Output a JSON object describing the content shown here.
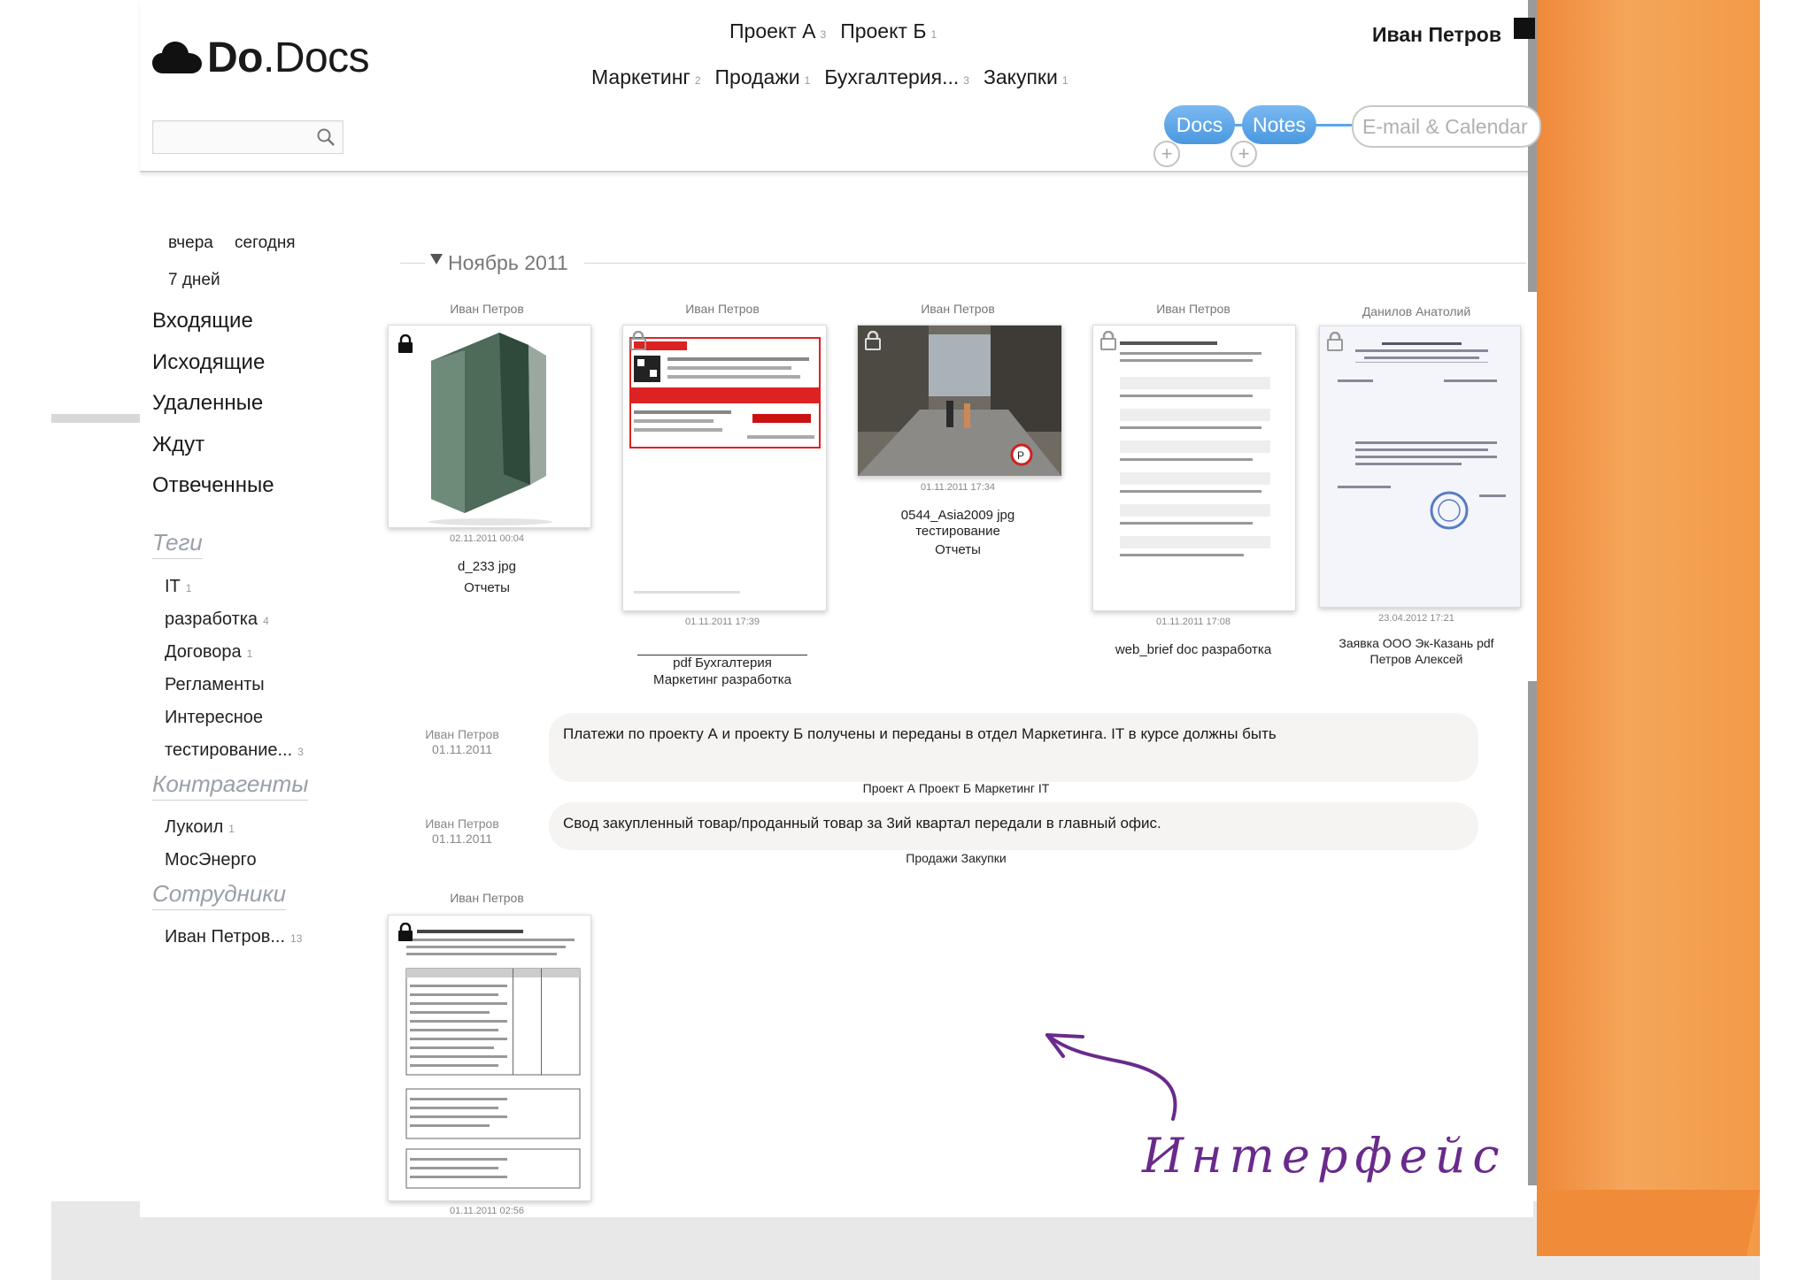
{
  "app": {
    "logo_bold": "Do",
    "logo_rest": ".Docs"
  },
  "search": {
    "placeholder": ""
  },
  "nav": {
    "row1": [
      {
        "label": "Проект А",
        "count": "3"
      },
      {
        "label": "Проект Б",
        "count": "1"
      }
    ],
    "row2": [
      {
        "label": "Маркетинг",
        "count": "2"
      },
      {
        "label": "Продажи",
        "count": "1"
      },
      {
        "label": "Бухгалтерия...",
        "count": "3"
      },
      {
        "label": "Закупки",
        "count": "1"
      }
    ]
  },
  "user": {
    "name": "Иван Петров"
  },
  "tabs": {
    "docs": "Docs",
    "notes": "Notes",
    "email": "E-mail & Calendar"
  },
  "sidebar": {
    "yesterday": "вчера",
    "today": "сегодня",
    "week": "7 дней",
    "folders": [
      "Входящие",
      "Исходящие",
      "Удаленные",
      "Ждут",
      "Отвеченные"
    ],
    "tags_heading": "Теги",
    "tags": [
      {
        "label": "IT",
        "count": "1"
      },
      {
        "label": "разработка",
        "count": "4"
      },
      {
        "label": "Договора",
        "count": "1"
      },
      {
        "label": "Регламенты",
        "count": ""
      },
      {
        "label": "Интересное",
        "count": ""
      },
      {
        "label": "тестирование...",
        "count": "3"
      }
    ],
    "contractors_heading": "Контрагенты",
    "contractors": [
      {
        "label": "Лукоил",
        "count": "1"
      },
      {
        "label": "МосЭнерго",
        "count": ""
      }
    ],
    "employees_heading": "Сотрудники",
    "employees": [
      {
        "label": "Иван Петров...",
        "count": "13"
      }
    ]
  },
  "month": "Ноябрь 2011",
  "docs": [
    {
      "author": "Иван Петров",
      "date": "02.11.2011 00:04",
      "line1": "d_233 jpg",
      "line2": "Отчеты"
    },
    {
      "author": "Иван Петров",
      "date": "01.11.2011 17:39",
      "line1": "pdf Бухгалтерия",
      "line2": "Маркетинг разработка"
    },
    {
      "author": "Иван Петров",
      "date": "01.11.2011 17:34",
      "line1": "0544_Asia2009 jpg",
      "line2": "тестирование",
      "line3": "Отчеты"
    },
    {
      "author": "Иван Петров",
      "date": "01.11.2011 17:08",
      "line1": "web_brief doc разработка"
    },
    {
      "author": "Данилов Анатолий",
      "date": "23.04.2012 17:21",
      "line1": "Заявка ООО Эк-Казань pdf",
      "line2": "Петров Алексей"
    },
    {
      "author": "Иван Петров",
      "date": "01.11.2011 02:56"
    }
  ],
  "notes": [
    {
      "author": "Иван Петров",
      "date": "01.11.2011",
      "text": "Платежи по проекту А и проекту Б получены и переданы в отдел Маркетинга. IT в курсе должны быть",
      "tags": "Проект А Проект Б Маркетинг IT"
    },
    {
      "author": "Иван Петров",
      "date": "01.11.2011",
      "text": "Свод закупленный товар/проданный товар за 3ий квартал передали в главный офис.",
      "tags": "Продажи Закупки"
    }
  ],
  "annotation": "Интерфейс",
  "colors": {
    "accent": "#5aa7ec",
    "orange": "#f39a48",
    "handwriting": "#6a2a8c"
  }
}
